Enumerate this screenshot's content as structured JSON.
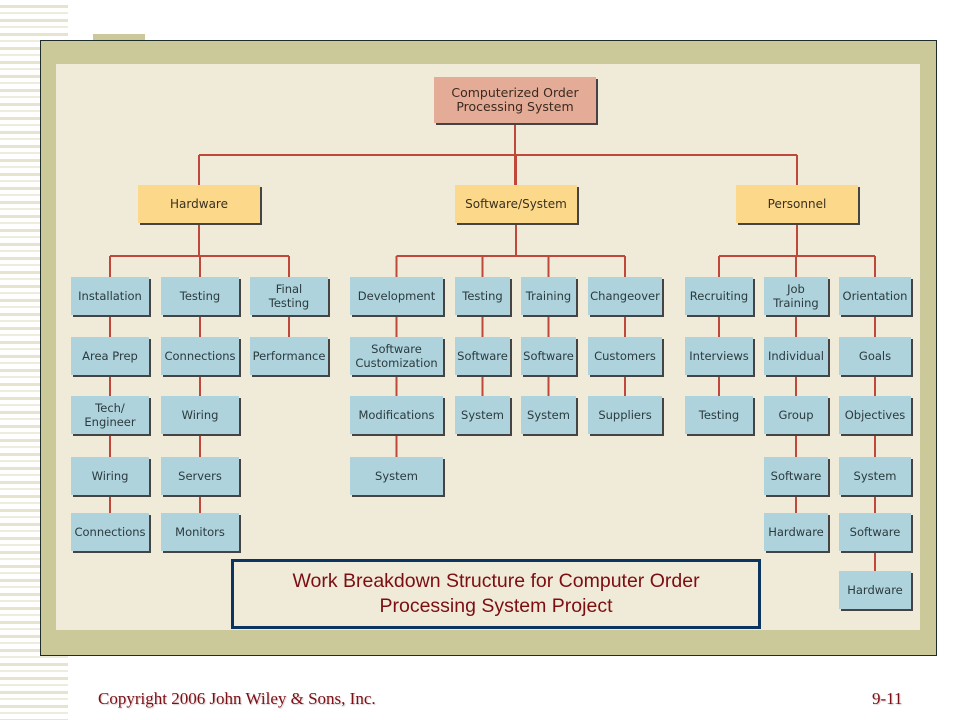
{
  "slide": {
    "caption_line1": "Work Breakdown Structure for Computer Order",
    "caption_line2": "Processing System Project",
    "copyright": "Copyright 2006 John Wiley & Sons, Inc.",
    "page_number": "9-11"
  },
  "colors": {
    "root_fill": "#e4ab96",
    "level1_fill": "#fcd98a",
    "leaf_fill": "#aed3dc",
    "connector": "#c0483a",
    "caption_text": "#7c0e12",
    "caption_border": "#0c3460",
    "panel": "#cbc99a",
    "canvas": "#f0ead8"
  },
  "wbs": {
    "root": "Computerized Order Processing System",
    "branches": [
      {
        "label": "Hardware",
        "columns": [
          [
            "Installation",
            "Area Prep",
            "Tech/ Engineer",
            "Wiring",
            "Connections"
          ],
          [
            "Testing",
            "Connections",
            "Wiring",
            "Servers",
            "Monitors"
          ],
          [
            "Final Testing",
            "Performance"
          ]
        ]
      },
      {
        "label": "Software/System",
        "columns": [
          [
            "Development",
            "Software Customization",
            "Modifications",
            "System"
          ],
          [
            "Testing",
            "Software",
            "System"
          ],
          [
            "Training",
            "Software",
            "System"
          ],
          [
            "Changeover",
            "Customers",
            "Suppliers"
          ]
        ]
      },
      {
        "label": "Personnel",
        "columns": [
          [
            "Recruiting",
            "Interviews",
            "Testing"
          ],
          [
            "Job Training",
            "Individual",
            "Group",
            "Software",
            "Hardware"
          ],
          [
            "Orientation",
            "Goals",
            "Objectives",
            "System",
            "Software",
            "Hardware"
          ]
        ]
      }
    ]
  }
}
